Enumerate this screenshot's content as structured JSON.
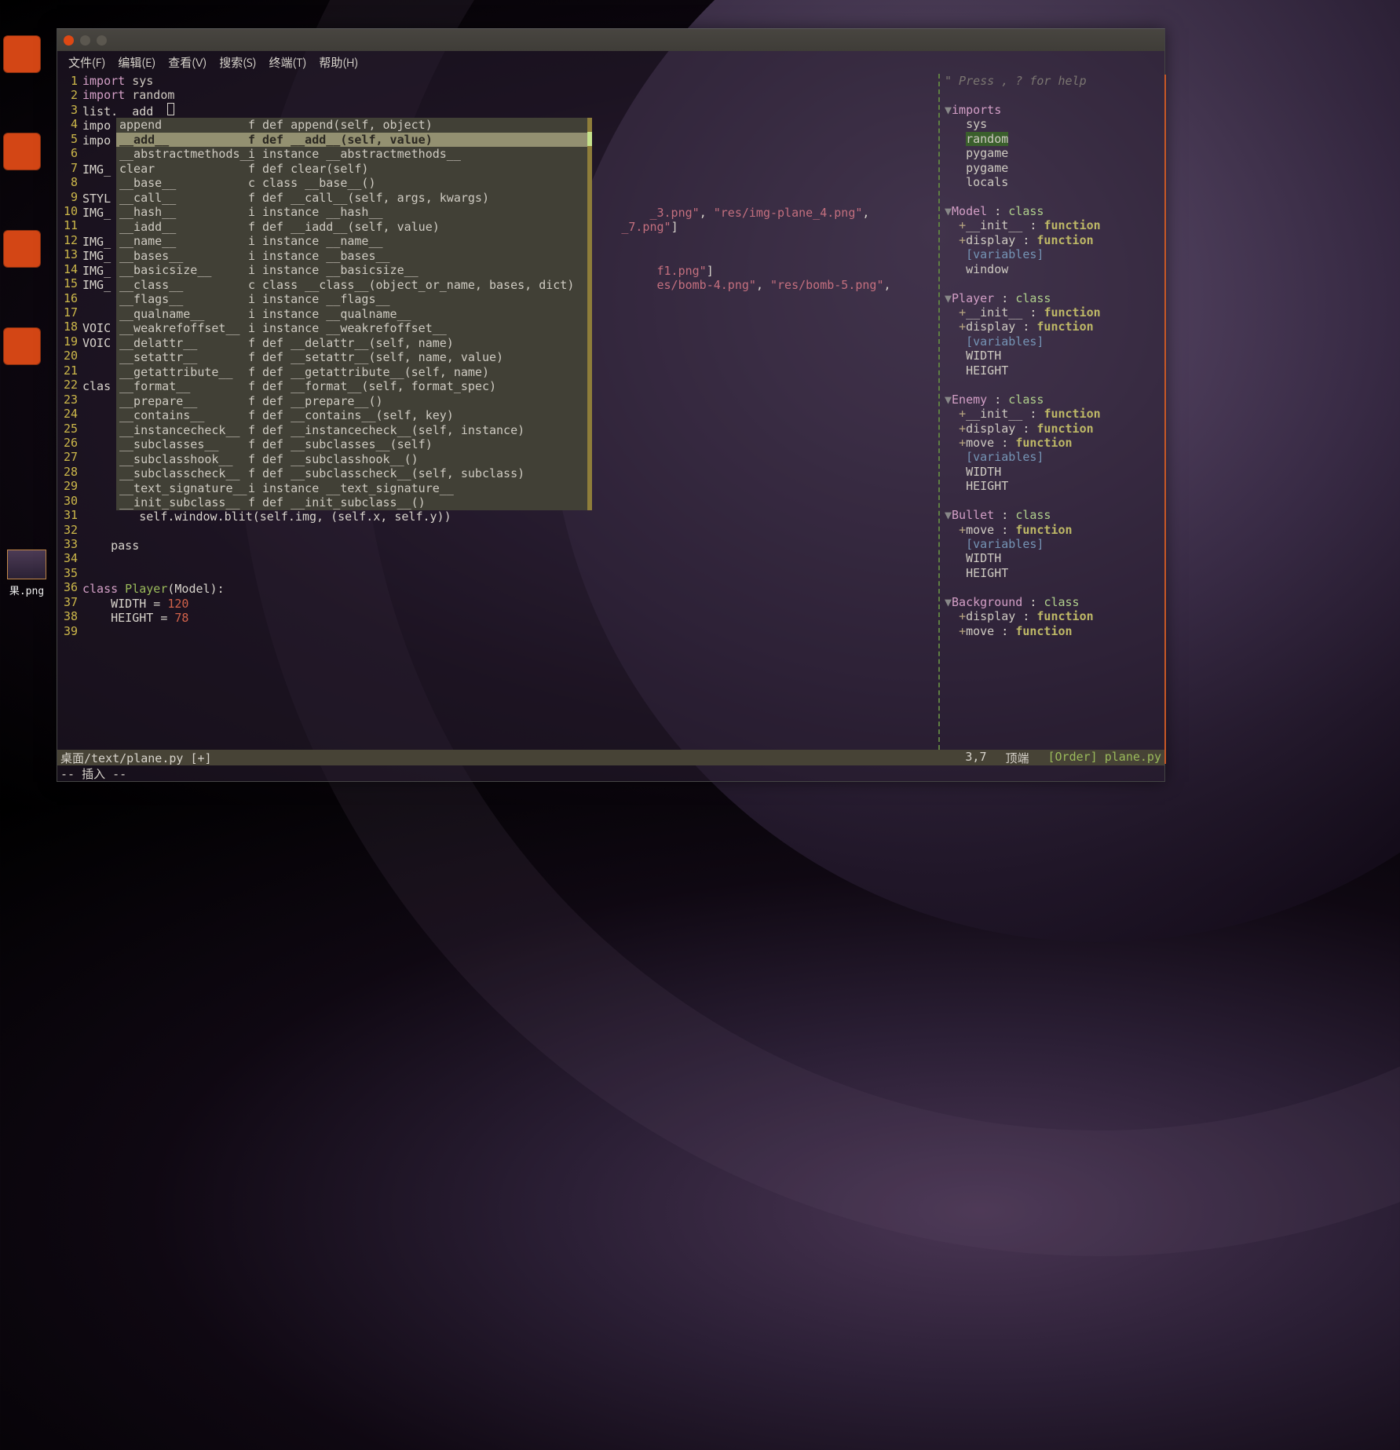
{
  "desktop": {
    "file_label": "果.png"
  },
  "menubar": {
    "file": "文件(F)",
    "edit": "编辑(E)",
    "view": "查看(V)",
    "search": "搜索(S)",
    "terminal": "终端(T)",
    "help": "帮助(H)"
  },
  "gutter_start": 1,
  "gutter_end": 39,
  "code_visible": {
    "l1_import": "import",
    "l1_mod": "sys",
    "l2_import": "import",
    "l2_mod": "random",
    "l3": "list.__add__",
    "l4_pre": "impo",
    "l5_pre": "impo",
    "l7_pre": "IMG_",
    "l9_pre": "STYL",
    "l10_pre": "IMG_",
    "l12_pre": "IMG_",
    "l13_pre": "IMG_",
    "l14_pre": "IMG_",
    "l15_pre": "IMG_",
    "l18_pre": "VOIC",
    "l19_pre": "VOIC",
    "l22_pre": "clas",
    "peek_10a": "_3.png\"",
    "peek_10b": ", ",
    "peek_10c": "\"res/img-plane_4.png\"",
    "peek_10d": ",",
    "peek_11a": "_7.png\"",
    "peek_11b": "]",
    "peek_14a": "f1.png\"",
    "peek_14b": "]",
    "peek_15a": "es/bomb-4.png\"",
    "peek_15b": ", ",
    "peek_15c": "\"res/bomb-5.png\"",
    "peek_15d": ",",
    "l31": "        self.window.blit(self.img, (self.x, self.y))",
    "l33": "    pass",
    "l36_class": "class",
    "l36_name": " Player",
    "l36_rest": "(Model):",
    "l37_a": "    WIDTH = ",
    "l37_n": "120",
    "l38_a": "    HEIGHT = ",
    "l38_n": "78"
  },
  "autocomplete": [
    {
      "name": "append",
      "kind": "f",
      "sig": "def append(self, object)",
      "sel": false
    },
    {
      "name": "__add__",
      "kind": "f",
      "sig": "def __add__(self, value)",
      "sel": true
    },
    {
      "name": "__abstractmethods__",
      "kind": "i",
      "sig": "instance __abstractmethods__",
      "sel": false
    },
    {
      "name": "clear",
      "kind": "f",
      "sig": "def clear(self)",
      "sel": false
    },
    {
      "name": "__base__",
      "kind": "c",
      "sig": "class __base__()",
      "sel": false
    },
    {
      "name": "__call__",
      "kind": "f",
      "sig": "def __call__(self, args, kwargs)",
      "sel": false
    },
    {
      "name": "__hash__",
      "kind": "i",
      "sig": "instance __hash__",
      "sel": false
    },
    {
      "name": "__iadd__",
      "kind": "f",
      "sig": "def __iadd__(self, value)",
      "sel": false
    },
    {
      "name": "__name__",
      "kind": "i",
      "sig": "instance __name__",
      "sel": false
    },
    {
      "name": "__bases__",
      "kind": "i",
      "sig": "instance __bases__",
      "sel": false
    },
    {
      "name": "__basicsize__",
      "kind": "i",
      "sig": "instance __basicsize__",
      "sel": false
    },
    {
      "name": "__class__",
      "kind": "c",
      "sig": "class __class__(object_or_name, bases, dict)",
      "sel": false
    },
    {
      "name": "__flags__",
      "kind": "i",
      "sig": "instance __flags__",
      "sel": false
    },
    {
      "name": "__qualname__",
      "kind": "i",
      "sig": "instance __qualname__",
      "sel": false
    },
    {
      "name": "__weakrefoffset__",
      "kind": "i",
      "sig": "instance __weakrefoffset__",
      "sel": false
    },
    {
      "name": "__delattr__",
      "kind": "f",
      "sig": "def __delattr__(self, name)",
      "sel": false
    },
    {
      "name": "__setattr__",
      "kind": "f",
      "sig": "def __setattr__(self, name, value)",
      "sel": false
    },
    {
      "name": "__getattribute__",
      "kind": "f",
      "sig": "def __getattribute__(self, name)",
      "sel": false
    },
    {
      "name": "__format__",
      "kind": "f",
      "sig": "def __format__(self, format_spec)",
      "sel": false
    },
    {
      "name": "__prepare__",
      "kind": "f",
      "sig": "def __prepare__()",
      "sel": false
    },
    {
      "name": "__contains__",
      "kind": "f",
      "sig": "def __contains__(self, key)",
      "sel": false
    },
    {
      "name": "__instancecheck__",
      "kind": "f",
      "sig": "def __instancecheck__(self, instance)",
      "sel": false
    },
    {
      "name": "__subclasses__",
      "kind": "f",
      "sig": "def __subclasses__(self)",
      "sel": false
    },
    {
      "name": "__subclasshook__",
      "kind": "f",
      "sig": "def __subclasshook__()",
      "sel": false
    },
    {
      "name": "__subclasscheck__",
      "kind": "f",
      "sig": "def __subclasscheck__(self, subclass)",
      "sel": false
    },
    {
      "name": "__text_signature__",
      "kind": "i",
      "sig": "instance __text_signature__",
      "sel": false
    },
    {
      "name": "__init_subclass__",
      "kind": "f",
      "sig": "def __init_subclass__()",
      "sel": false
    }
  ],
  "tagbar": {
    "help": "\" Press <F1>, ? for help",
    "imports_label": "imports",
    "imports": [
      "sys",
      "random",
      "pygame",
      "pygame",
      "locals"
    ],
    "hl_import": "random",
    "classes": [
      {
        "name": "Model",
        "funcs": [
          "__init__",
          "display"
        ],
        "vars": [
          "window"
        ]
      },
      {
        "name": "Player",
        "funcs": [
          "__init__",
          "display"
        ],
        "vars": [
          "WIDTH",
          "HEIGHT"
        ]
      },
      {
        "name": "Enemy",
        "funcs": [
          "__init__",
          "display",
          "move"
        ],
        "vars": [
          "WIDTH",
          "HEIGHT"
        ]
      },
      {
        "name": "Bullet",
        "funcs": [
          "move"
        ],
        "vars": [
          "WIDTH",
          "HEIGHT"
        ]
      },
      {
        "name": "Background",
        "funcs": [
          "display",
          "move"
        ],
        "vars": []
      }
    ],
    "class_kw": "class",
    "func_kw": "function",
    "vars_label": "[variables]"
  },
  "status": {
    "left": "桌面/text/plane.py [+]",
    "pos": "3,7",
    "scroll": "顶端",
    "right": "[Order] plane.py"
  },
  "mode": "-- 插入 --"
}
